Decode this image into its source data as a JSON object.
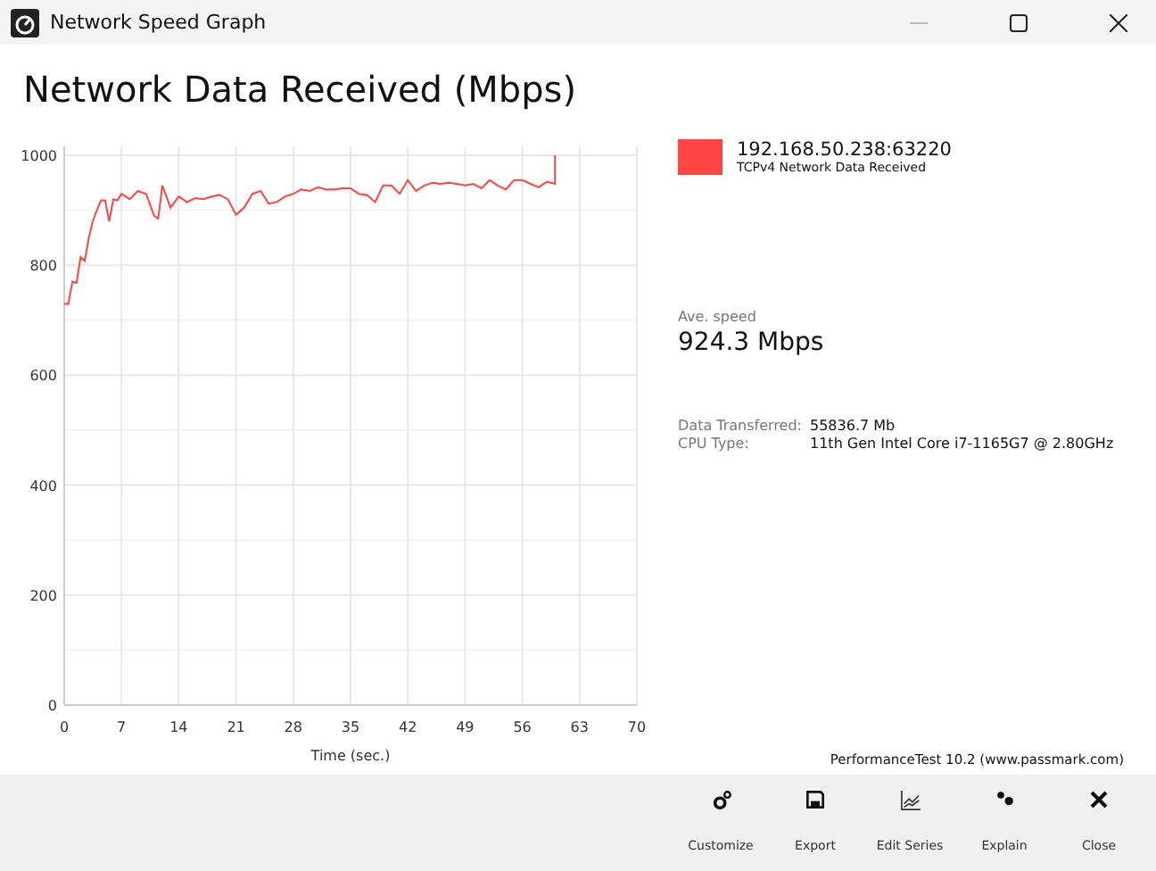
{
  "window": {
    "title": "Network Speed Graph"
  },
  "heading": "Network Data Received (Mbps)",
  "chart_data": {
    "type": "line",
    "xlabel": "Time (sec.)",
    "xlim": [
      0,
      70
    ],
    "ylim": [
      0,
      1000
    ],
    "xticks": [
      0,
      7,
      14,
      21,
      28,
      35,
      42,
      49,
      56,
      63,
      70
    ],
    "yticks": [
      0,
      200,
      400,
      600,
      800,
      1000
    ],
    "grid": true,
    "x": [
      0,
      0.5,
      1,
      1.5,
      2,
      2.5,
      3,
      3.5,
      4,
      4.5,
      5,
      5.5,
      6,
      6.5,
      7,
      8,
      9,
      10,
      11,
      11.5,
      12,
      13,
      14,
      15,
      16,
      17,
      18,
      19,
      20,
      21,
      22,
      23,
      24,
      25,
      26,
      27,
      28,
      29,
      30,
      31,
      32,
      33,
      34,
      35,
      36,
      37,
      38,
      39,
      40,
      41,
      42,
      43,
      44,
      45,
      46,
      47,
      48,
      49,
      50,
      51,
      52,
      53,
      54,
      55,
      56,
      57,
      58,
      59,
      60,
      60
    ],
    "series": [
      {
        "name": "192.168.50.238:63220",
        "color": "#ff4444",
        "values": [
          730,
          730,
          770,
          768,
          815,
          808,
          850,
          880,
          900,
          918,
          918,
          880,
          920,
          918,
          930,
          920,
          935,
          930,
          890,
          885,
          945,
          905,
          925,
          915,
          922,
          920,
          925,
          928,
          920,
          892,
          905,
          930,
          935,
          912,
          915,
          925,
          930,
          938,
          935,
          942,
          938,
          938,
          940,
          940,
          930,
          928,
          915,
          945,
          945,
          930,
          955,
          935,
          945,
          950,
          948,
          950,
          948,
          945,
          948,
          940,
          955,
          945,
          938,
          955,
          955,
          948,
          942,
          952,
          948,
          1000
        ]
      }
    ]
  },
  "legend": {
    "sublabel": "TCPv4 Network Data Received"
  },
  "average": {
    "label": "Ave. speed",
    "value": "924.3 Mbps"
  },
  "details": [
    {
      "label": "Data Transferred:",
      "value": "55836.7 Mb"
    },
    {
      "label": "CPU Type:",
      "value": "11th Gen Intel Core i7-1165G7 @ 2.80GHz"
    }
  ],
  "credit": "PerformanceTest 10.2 (www.passmark.com)",
  "toolbar": [
    {
      "kind": "customize",
      "label": "Customize"
    },
    {
      "kind": "export",
      "label": "Export"
    },
    {
      "kind": "edit",
      "label": "Edit Series"
    },
    {
      "kind": "explain",
      "label": "Explain"
    },
    {
      "kind": "close",
      "label": "Close"
    }
  ]
}
